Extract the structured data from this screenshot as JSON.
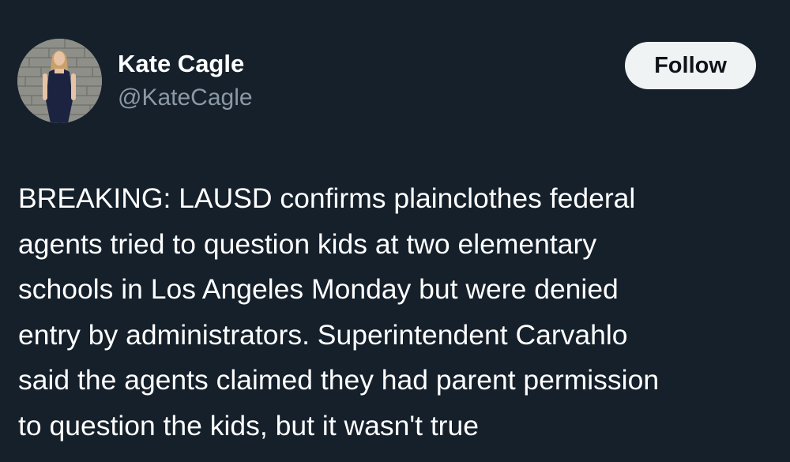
{
  "author": {
    "display_name": "Kate Cagle",
    "handle": "@KateCagle",
    "avatar_icon": "profile-photo"
  },
  "follow_button": {
    "label": "Follow"
  },
  "tweet": {
    "lines": [
      "BREAKING: LAUSD confirms plainclothes federal",
      "agents tried to question kids at two elementary",
      "schools in Los Angeles Monday but were denied",
      "entry by administrators. Superintendent Carvahlo",
      "said the agents claimed they had parent permission",
      "to question the kids, but it wasn't true"
    ]
  },
  "colors": {
    "background": "#15202b",
    "primary_text": "#ffffff",
    "secondary_text": "#8b98a5",
    "button_bg": "#eff3f4",
    "button_text": "#0f1419"
  }
}
